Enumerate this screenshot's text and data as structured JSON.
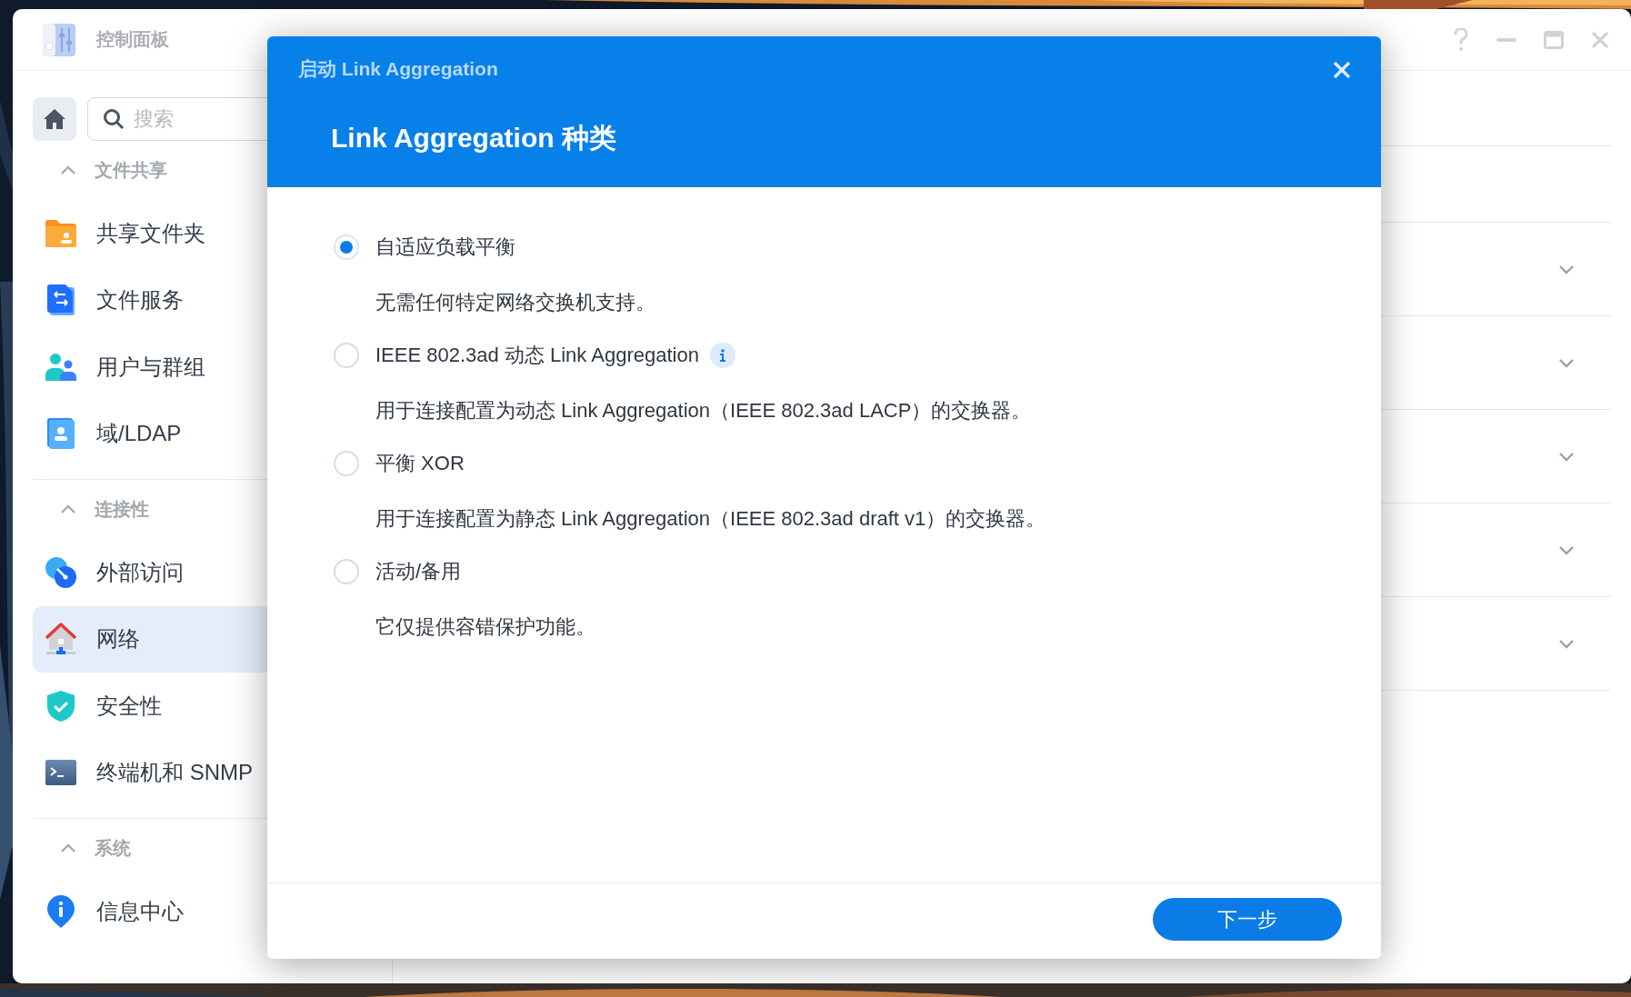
{
  "window": {
    "title": "控制面板"
  },
  "sidebar": {
    "search": {
      "placeholder": "搜索"
    },
    "sections": [
      {
        "title": "文件共享",
        "expanded": true,
        "items": [
          {
            "label": "共享文件夹",
            "kind": "folder",
            "selected": false
          },
          {
            "label": "文件服务",
            "kind": "transfer",
            "selected": false
          },
          {
            "label": "用户与群组",
            "kind": "users",
            "selected": false
          },
          {
            "label": "域/LDAP",
            "kind": "directory",
            "selected": false
          }
        ]
      },
      {
        "title": "连接性",
        "expanded": true,
        "items": [
          {
            "label": "外部访问",
            "kind": "access",
            "selected": false
          },
          {
            "label": "网络",
            "kind": "network",
            "selected": true
          },
          {
            "label": "安全性",
            "kind": "shield",
            "selected": false
          },
          {
            "label": "终端机和 SNMP",
            "kind": "terminal",
            "selected": false
          }
        ]
      },
      {
        "title": "系统",
        "expanded": true,
        "items": [
          {
            "label": "信息中心",
            "kind": "info",
            "selected": false
          }
        ]
      }
    ]
  },
  "panel_rows": [
    {
      "expanded": false
    },
    {
      "expanded": false
    },
    {
      "expanded": false
    },
    {
      "expanded": false
    },
    {
      "expanded": false
    }
  ],
  "dialog": {
    "title": "启动 Link Aggregation",
    "heading": "Link Aggregation 种类",
    "options": [
      {
        "label": "自适应负载平衡",
        "description": "无需任何特定网络交换机支持。",
        "selected": true,
        "info": false
      },
      {
        "label": "IEEE 802.3ad 动态 Link Aggregation",
        "description": "用于连接配置为动态 Link Aggregation（IEEE 802.3ad LACP）的交换器。",
        "selected": false,
        "info": true
      },
      {
        "label": "平衡 XOR",
        "description": "用于连接配置为静态 Link Aggregation（IEEE 802.3ad draft v1）的交换器。",
        "selected": false,
        "info": false
      },
      {
        "label": "活动/备用",
        "description": "它仅提供容错保护功能。",
        "selected": false,
        "info": false
      }
    ],
    "next_button": "下一步"
  }
}
